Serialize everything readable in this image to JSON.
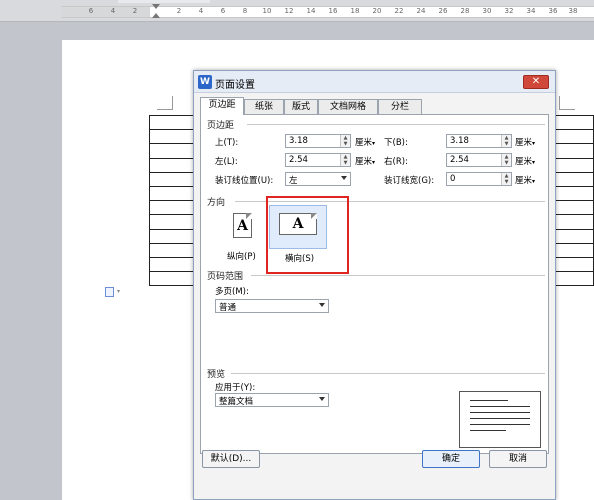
{
  "ruler": {
    "numbers": [
      "6",
      "4",
      "2",
      "2",
      "4",
      "6",
      "8",
      "10",
      "12",
      "14",
      "16",
      "18",
      "20",
      "22",
      "24",
      "26",
      "28",
      "30",
      "32",
      "34",
      "36",
      "38",
      "40"
    ]
  },
  "dialog": {
    "title": "页面设置",
    "app_icon_glyph": "W",
    "close_glyph": "✕",
    "tabs": [
      "页边距",
      "纸张",
      "版式",
      "文档网格",
      "分栏"
    ],
    "active_tab": "页边距",
    "margins": {
      "section_title": "页边距",
      "top_label": "上(T):",
      "top_value": "3.18",
      "bottom_label": "下(B):",
      "bottom_value": "3.18",
      "left_label": "左(L):",
      "left_value": "2.54",
      "right_label": "右(R):",
      "right_value": "2.54",
      "unit": "厘米",
      "gutter_pos_label": "装订线位置(U):",
      "gutter_pos_value": "左",
      "gutter_width_label": "装订线宽(G):",
      "gutter_width_value": "0"
    },
    "orientation": {
      "section_title": "方向",
      "glyph": "A",
      "portrait_label": "纵向(P)",
      "landscape_label": "横向(S)",
      "selected": "横向(S)"
    },
    "pages": {
      "section_title": "页码范围",
      "multiple_label": "多页(M):",
      "multiple_value": "普通"
    },
    "preview": {
      "section_title": "预览",
      "apply_label": "应用于(Y):",
      "apply_value": "整篇文档"
    },
    "buttons": {
      "default": "默认(D)...",
      "ok": "确定",
      "cancel": "取消"
    }
  },
  "colors": {
    "highlight_box": "#e0241f",
    "close_button": "#d0483a",
    "app_icon": "#2c66c9"
  }
}
